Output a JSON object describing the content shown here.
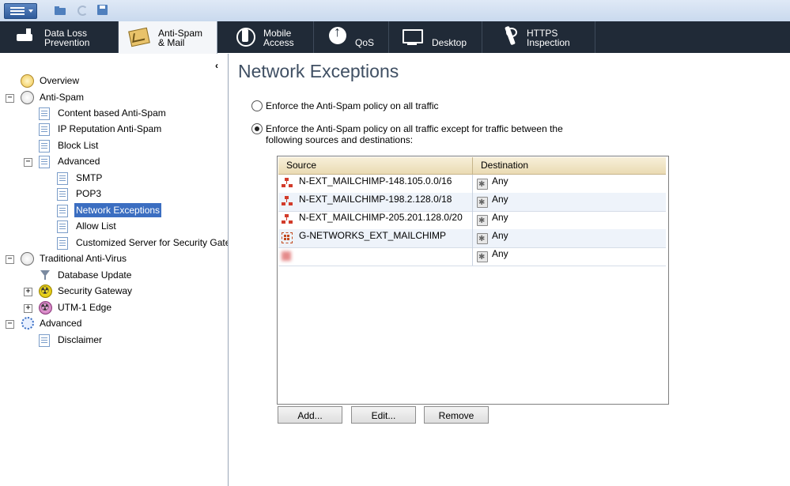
{
  "tabs": [
    {
      "label": "Data Loss\nPrevention"
    },
    {
      "label": "Anti-Spam\n& Mail"
    },
    {
      "label": "Mobile\nAccess"
    },
    {
      "label": "QoS"
    },
    {
      "label": "Desktop"
    },
    {
      "label": "HTTPS\nInspection"
    }
  ],
  "tree": {
    "overview": "Overview",
    "anti_spam": "Anti-Spam",
    "content_based": "Content based Anti-Spam",
    "ip_reputation": "IP Reputation Anti-Spam",
    "block_list": "Block List",
    "advanced": "Advanced",
    "smtp": "SMTP",
    "pop3": "POP3",
    "network_exceptions": "Network Exceptions",
    "allow_list": "Allow List",
    "customized_server": "Customized Server for Security Gateway",
    "traditional_av": "Traditional Anti-Virus",
    "database_update": "Database Update",
    "security_gateway": "Security Gateway",
    "utm_edge": "UTM-1 Edge",
    "advanced2": "Advanced",
    "disclaimer": "Disclaimer"
  },
  "main": {
    "title": "Network Exceptions",
    "radio_all": "Enforce the Anti-Spam policy on all traffic",
    "radio_except": "Enforce the Anti-Spam policy on all traffic except for traffic between the following sources and destinations:",
    "table": {
      "headers": [
        "Source",
        "Destination"
      ],
      "rows": [
        {
          "source": "N-EXT_MAILCHIMP-148.105.0.0/16",
          "destination": "Any"
        },
        {
          "source": "N-EXT_MAILCHIMP-198.2.128.0/18",
          "destination": "Any"
        },
        {
          "source": "N-EXT_MAILCHIMP-205.201.128.0/20",
          "destination": "Any"
        },
        {
          "source": "G-NETWORKS_EXT_MAILCHIMP",
          "destination": "Any"
        },
        {
          "source": "",
          "destination": "Any"
        }
      ]
    },
    "buttons": {
      "add": "Add...",
      "edit": "Edit...",
      "remove": "Remove"
    }
  }
}
